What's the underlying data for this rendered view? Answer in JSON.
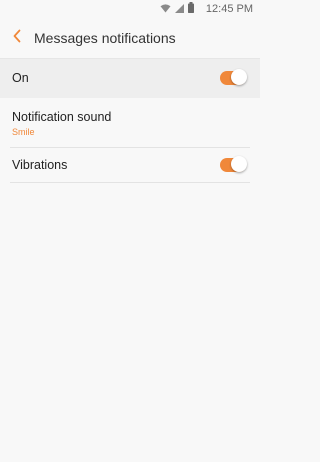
{
  "status_bar": {
    "time": "12:45 PM",
    "icons": [
      "wifi-icon",
      "signal-icon",
      "battery-icon"
    ]
  },
  "header": {
    "back_icon": "chevron-left-icon",
    "title": "Messages notifications"
  },
  "settings": {
    "on": {
      "label": "On",
      "enabled": true
    },
    "notification_sound": {
      "label": "Notification sound",
      "value": "Smile"
    },
    "vibrations": {
      "label": "Vibrations",
      "enabled": true
    }
  },
  "colors": {
    "accent": "#f0883a",
    "background": "#f8f8f8",
    "highlight_row": "#eeeeee"
  }
}
